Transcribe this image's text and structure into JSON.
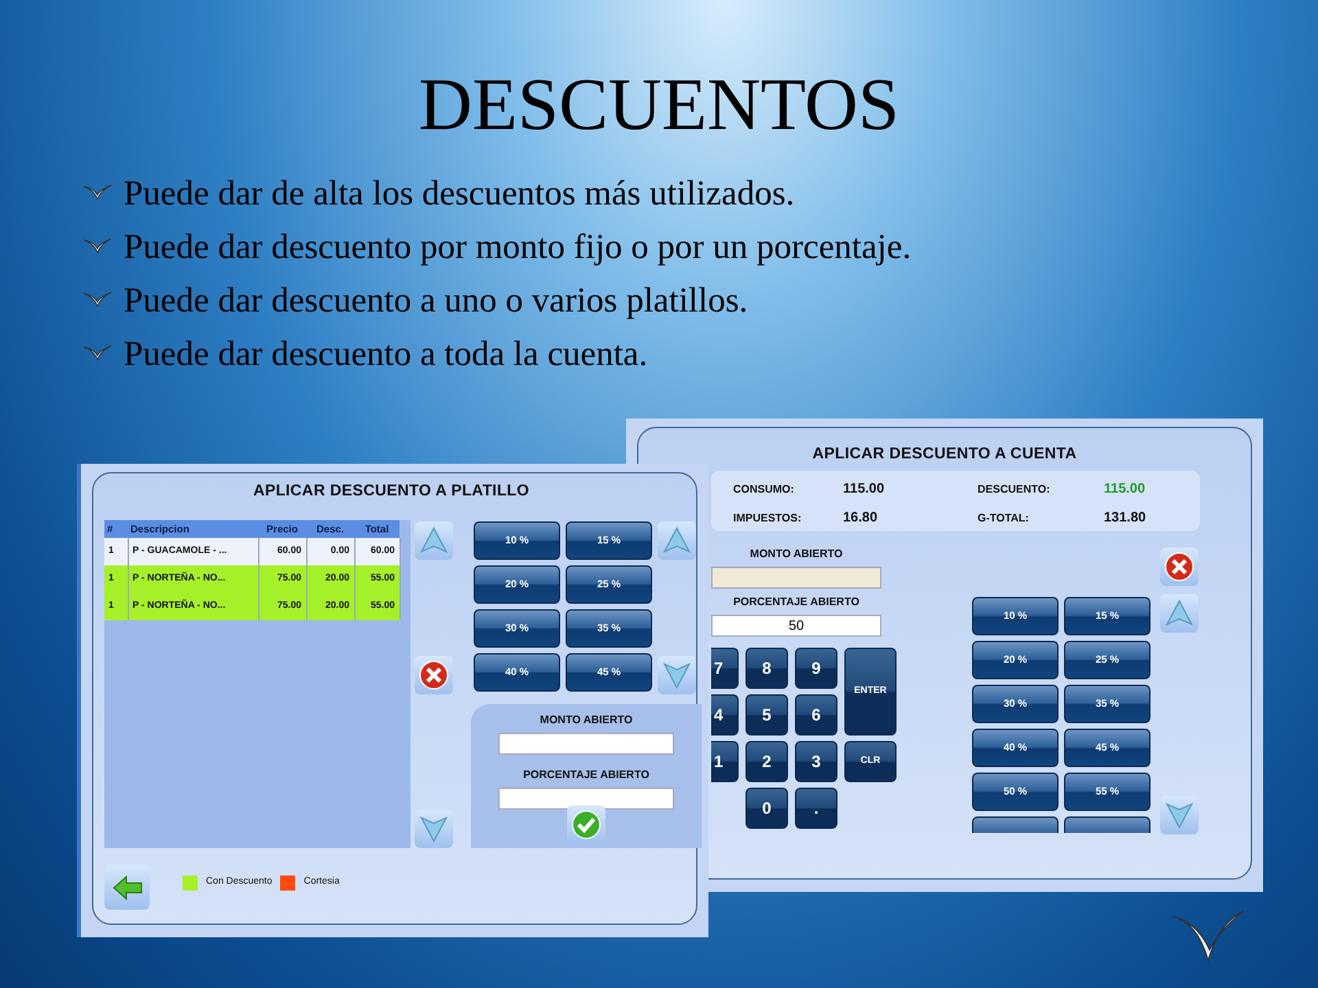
{
  "slide": {
    "title": "DESCUENTOS",
    "bullets": [
      "Puede dar de alta los descuentos más utilizados.",
      "Puede dar descuento por monto fijo o por un porcentaje.",
      "Puede dar descuento a uno o varios platillos.",
      "Puede dar descuento a toda la cuenta."
    ]
  },
  "platillo_window": {
    "title": "APLICAR DESCUENTO A PLATILLO",
    "table": {
      "columns": [
        "#",
        "Descripcion",
        "Precio",
        "Desc.",
        "Total"
      ],
      "rows": [
        {
          "cells": [
            "1",
            "P - GUACAMOLE - ...",
            "60.00",
            "0.00",
            "60.00"
          ],
          "discounted": false
        },
        {
          "cells": [
            "1",
            "P - NORTEÑA - NO...",
            "75.00",
            "20.00",
            "55.00"
          ],
          "discounted": true
        },
        {
          "cells": [
            "1",
            "P - NORTEÑA - NO...",
            "75.00",
            "20.00",
            "55.00"
          ],
          "discounted": true
        }
      ]
    },
    "percent_buttons": [
      "10 %",
      "15 %",
      "20 %",
      "25 %",
      "30 %",
      "35 %",
      "40 %",
      "45 %"
    ],
    "open_panel": {
      "amount_label": "MONTO ABIERTO",
      "percent_label": "PORCENTAJE ABIERTO"
    },
    "legend": [
      {
        "label": "Con Descuento",
        "color": "#a6f02a"
      },
      {
        "label": "Cortesia",
        "color": "#ff4a12"
      }
    ]
  },
  "cuenta_window": {
    "title": "APLICAR DESCUENTO A CUENTA",
    "summary": [
      {
        "label": "CONSUMO:",
        "value": "115.00",
        "highlighted": false
      },
      {
        "label": "DESCUENTO:",
        "value": "115.00",
        "highlighted": true
      },
      {
        "label": "IMPUESTOS:",
        "value": "16.80",
        "highlighted": false
      },
      {
        "label": "G-TOTAL:",
        "value": "131.80",
        "highlighted": false
      }
    ],
    "amount_label": "MONTO ABIERTO",
    "percent_label": "PORCENTAJE ABIERTO",
    "percent_value": "50",
    "keypad": [
      {
        "label": "7",
        "kind": "key"
      },
      {
        "label": "8",
        "kind": "key"
      },
      {
        "label": "9",
        "kind": "key"
      },
      {
        "label": "ENTER",
        "kind": "tall"
      },
      {
        "label": "4",
        "kind": "key"
      },
      {
        "label": "5",
        "kind": "key"
      },
      {
        "label": "6",
        "kind": "key"
      },
      {
        "label": "1",
        "kind": "key"
      },
      {
        "label": "2",
        "kind": "key"
      },
      {
        "label": "3",
        "kind": "key"
      },
      {
        "label": "CLR",
        "kind": "small"
      },
      {
        "label": "0",
        "kind": "offset"
      },
      {
        "label": ".",
        "kind": "key"
      }
    ],
    "percent_buttons": [
      "10 %",
      "15 %",
      "20 %",
      "25 %",
      "30 %",
      "35 %",
      "40 %",
      "45 %",
      "50 %",
      "55 %"
    ]
  }
}
